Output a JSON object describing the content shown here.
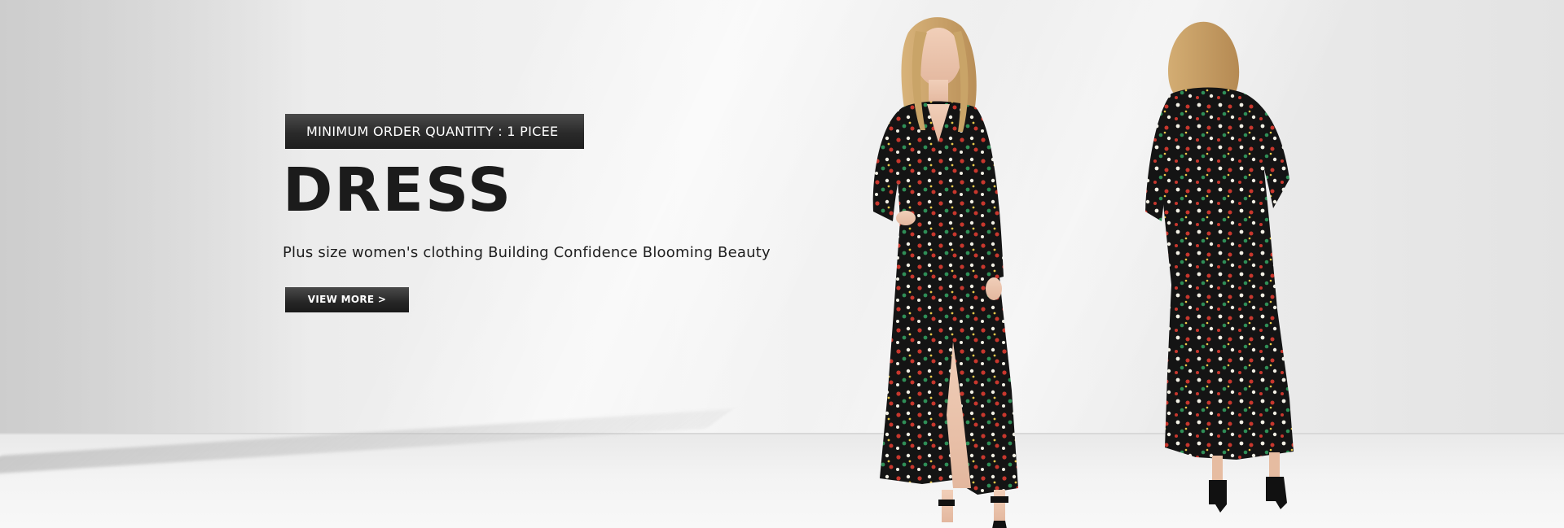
{
  "banner": {
    "min_order_label": "MINIMUM ORDER QUANTITY : 1 PICEE",
    "title": "DRESS",
    "subtitle": "Plus size women's clothing Building Confidence Blooming Beauty",
    "cta_label": "VIEW MORE >"
  },
  "images": {
    "front_model": "model-front-floral-dress",
    "back_model": "model-back-floral-dress"
  },
  "colors": {
    "dark_label": "#2a2a2a",
    "title_text": "#1b1b1b",
    "dress_base": "#141414",
    "flower_red": "#c8372d",
    "flower_white": "#f1efe4",
    "flower_green": "#2f8f57"
  }
}
